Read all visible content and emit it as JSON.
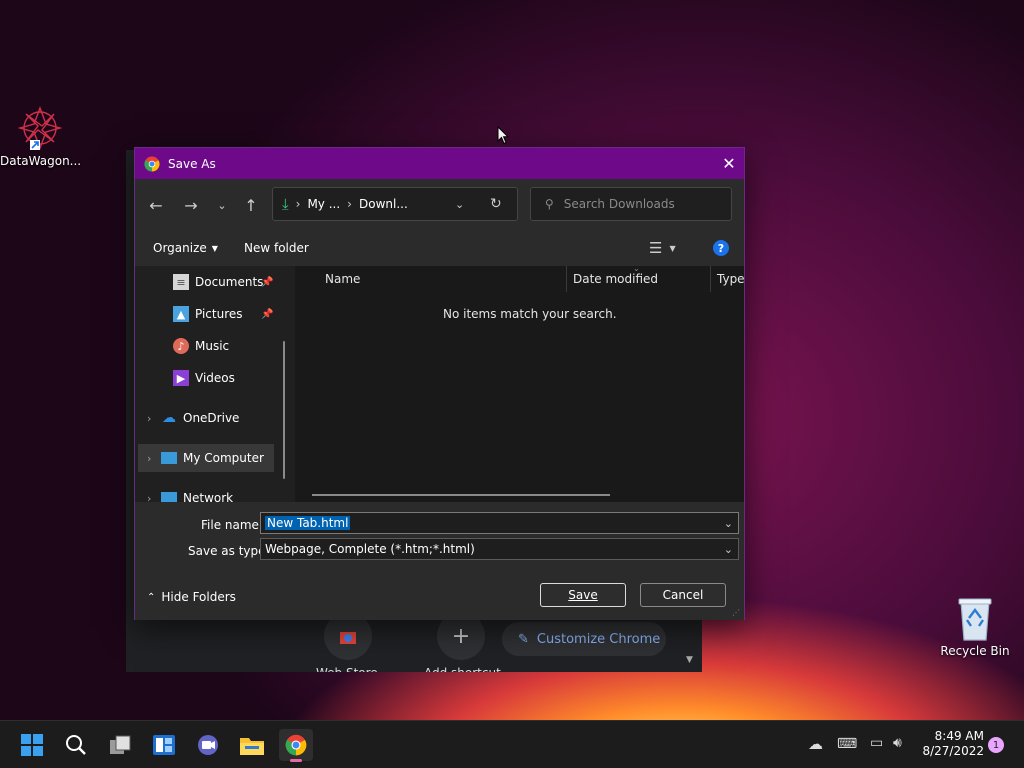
{
  "desktop": {
    "shortcut_label": "DataWagon...",
    "recycle_label": "Recycle Bin"
  },
  "chrome_bg": {
    "customize_label": "Customize Chrome",
    "webstore_label": "Web Store",
    "add_shortcut_label": "Add shortcut"
  },
  "dialog": {
    "title": "Save As",
    "address": {
      "part1": "My ...",
      "part2": "Downl..."
    },
    "search_placeholder": "Search Downloads",
    "toolbar": {
      "organize": "Organize",
      "new_folder": "New folder"
    },
    "nav_items": [
      {
        "label": "Documents",
        "icon": "documents-icon",
        "pinned": true
      },
      {
        "label": "Pictures",
        "icon": "pictures-icon",
        "pinned": true
      },
      {
        "label": "Music",
        "icon": "music-icon",
        "pinned": false
      },
      {
        "label": "Videos",
        "icon": "videos-icon",
        "pinned": false
      },
      {
        "label": "OneDrive",
        "icon": "onedrive-icon",
        "pinned": false
      },
      {
        "label": "My Computer",
        "icon": "computer-icon",
        "pinned": false,
        "selected": true
      },
      {
        "label": "Network",
        "icon": "network-icon",
        "pinned": false
      }
    ],
    "columns": [
      "Name",
      "Date modified",
      "Type"
    ],
    "empty_message": "No items match your search.",
    "file_name_label": "File name:",
    "file_name_value": "New Tab.html",
    "save_type_label": "Save as type:",
    "save_type_value": "Webpage, Complete (*.htm;*.html)",
    "hide_folders": "Hide Folders",
    "save_button": "Save",
    "cancel_button": "Cancel"
  },
  "taskbar": {
    "time": "8:49 AM",
    "date": "8/27/2022",
    "notification_count": "1"
  },
  "colors": {
    "titlebar": "#6e0a8a",
    "selection": "#0063b1",
    "accent_blue": "#3a8ee6"
  }
}
